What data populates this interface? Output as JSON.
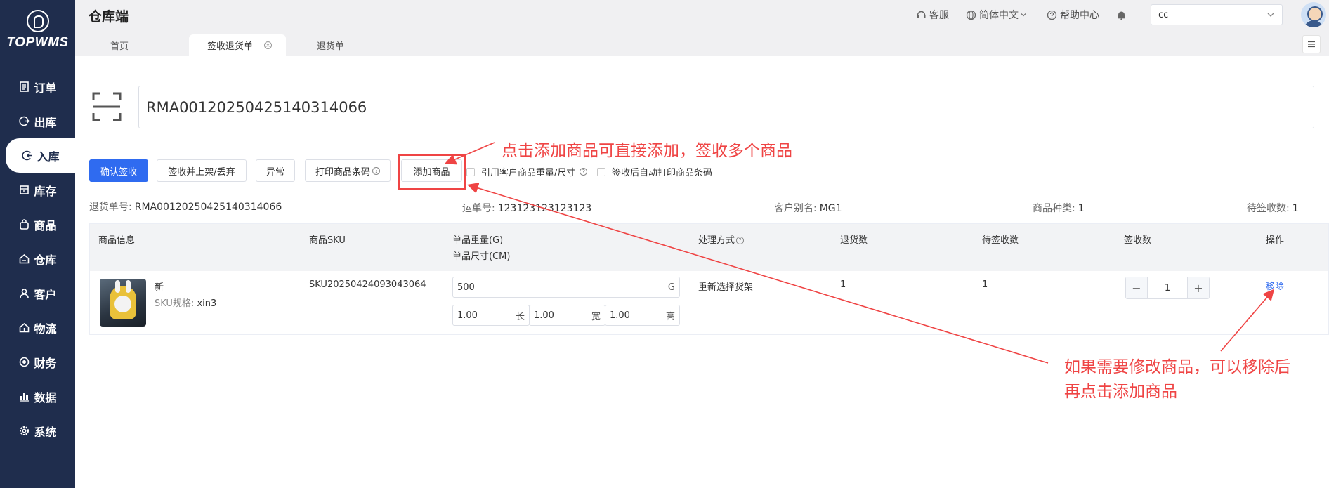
{
  "app": {
    "logo_text": "TOPWMS",
    "title": "仓库端"
  },
  "sidebar": {
    "items": [
      {
        "label": "订单",
        "icon": "document-icon"
      },
      {
        "label": "出库",
        "icon": "outbound-icon"
      },
      {
        "label": "入库",
        "icon": "inbound-icon",
        "active": true
      },
      {
        "label": "库存",
        "icon": "inventory-icon"
      },
      {
        "label": "商品",
        "icon": "bag-icon"
      },
      {
        "label": "仓库",
        "icon": "warehouse-icon"
      },
      {
        "label": "客户",
        "icon": "user-icon"
      },
      {
        "label": "物流",
        "icon": "truck-icon"
      },
      {
        "label": "财务",
        "icon": "finance-icon"
      },
      {
        "label": "数据",
        "icon": "chart-icon"
      },
      {
        "label": "系统",
        "icon": "gear-icon"
      }
    ]
  },
  "header": {
    "service": "客服",
    "language": "简体中文",
    "help": "帮助中心",
    "user_value": "cc"
  },
  "tabs": [
    {
      "label": "首页",
      "active": false
    },
    {
      "label": "签收退货单",
      "active": true
    },
    {
      "label": "退货单",
      "active": false
    }
  ],
  "scan": {
    "value": "RMA00120250425140314066"
  },
  "toolbar": {
    "confirm": "确认签收",
    "sign_shelve": "签收并上架/丢弃",
    "exception": "异常",
    "print_barcode": "打印商品条码",
    "add_goods": "添加商品",
    "ref_weight": "引用客户商品重量/尺寸",
    "auto_print": "签收后自动打印商品条码"
  },
  "summary": {
    "return_no_label": "退货单号:",
    "return_no": "RMA00120250425140314066",
    "waybill_label": "运单号:",
    "waybill": "123123123123123",
    "alias_label": "客户别名:",
    "alias": "MG1",
    "kinds_label": "商品种类:",
    "kinds": "1",
    "pending_label": "待签收数:",
    "pending": "1"
  },
  "table": {
    "headers": {
      "info": "商品信息",
      "sku": "商品SKU",
      "weight": "单品重量(G)",
      "size": "单品尺寸(CM)",
      "method": "处理方式",
      "return_qty": "退货数",
      "pending_qty": "待签收数",
      "sign_qty": "签收数",
      "op": "操作"
    },
    "rows": [
      {
        "name": "新",
        "spec_label": "SKU规格:",
        "spec": "xin3",
        "sku": "SKU20250424093043064",
        "weight": "500",
        "weight_unit": "G",
        "length": "1.00",
        "length_unit": "长",
        "width": "1.00",
        "width_unit": "宽",
        "height": "1.00",
        "height_unit": "高",
        "method": "重新选择货架",
        "return_qty": "1",
        "pending_qty": "1",
        "sign_qty": "1",
        "remove": "移除"
      }
    ]
  },
  "annotations": {
    "top": "点击添加商品可直接添加，签收多个商品",
    "bottom_line1": "如果需要修改商品，可以移除后",
    "bottom_line2": "再点击添加商品"
  },
  "colors": {
    "sidebar": "#1f2d4d",
    "primary": "#2f6bf0",
    "annotation": "#ef4444"
  }
}
